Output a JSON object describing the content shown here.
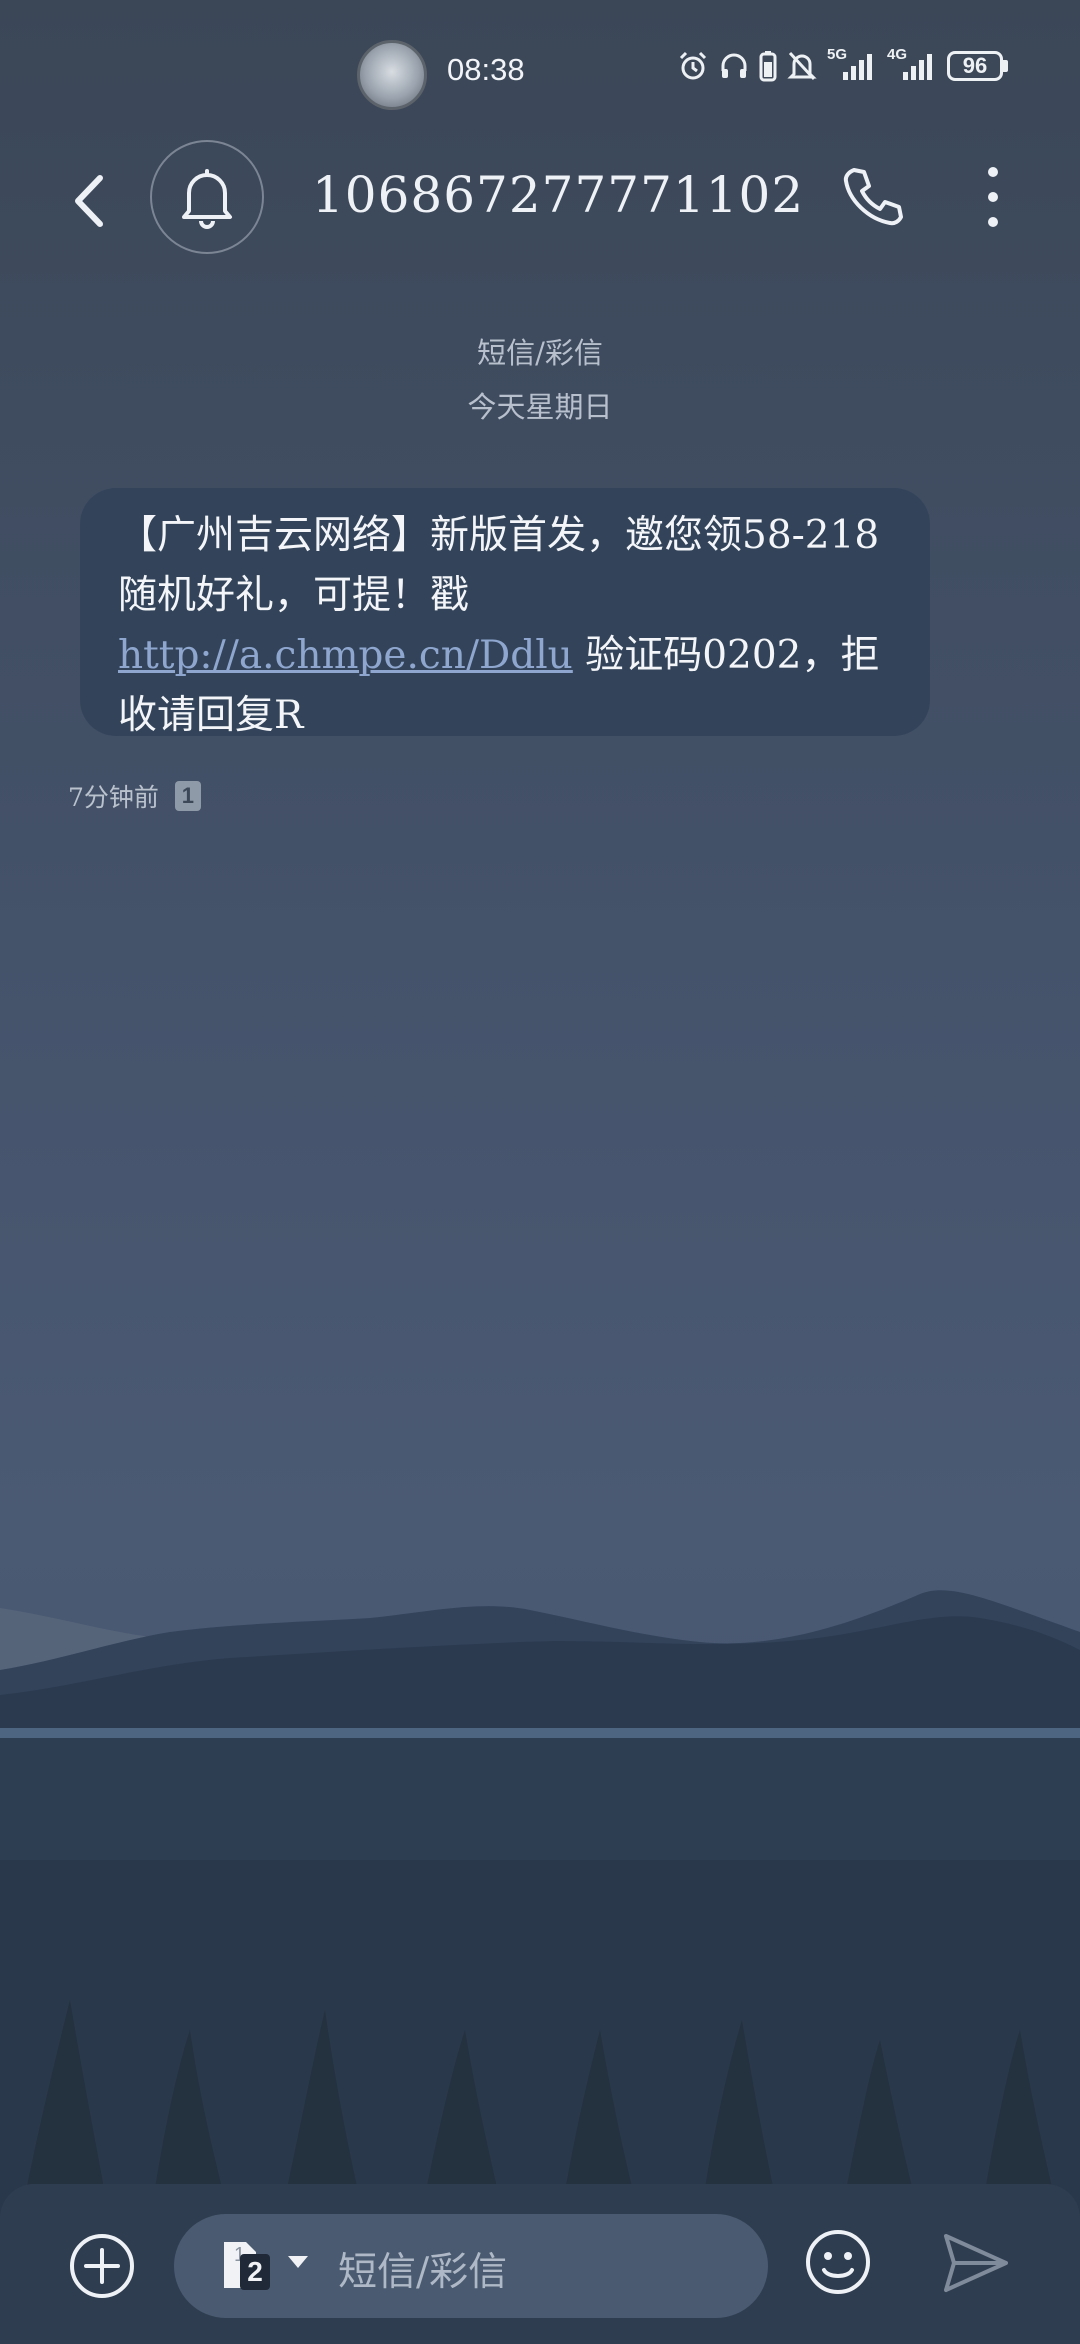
{
  "status_bar": {
    "time": "08:38",
    "battery": "96",
    "icons": [
      "avatar-icon",
      "alarm-icon",
      "headphones-icon",
      "battery-saver-icon",
      "mute-icon",
      "5g-signal-icon",
      "4g-signal-icon",
      "battery-icon"
    ],
    "network_5g": "5G",
    "network_4g": "4G"
  },
  "header": {
    "sender": "106867277771102",
    "icons": [
      "back-icon",
      "bell-icon",
      "phone-icon",
      "more-icon"
    ]
  },
  "conversation": {
    "channel": "短信/彩信",
    "date": "今天星期日",
    "message": {
      "text_before_link": "【广州吉云网络】新版首发，邀您领58-218随机好礼，可提！戳 ",
      "link": "http://a.chmpe.cn/Ddlu",
      "text_after_link": " 验证码0202，拒收请回复R",
      "time": "7分钟前",
      "sim": "1"
    }
  },
  "composer": {
    "placeholder": "短信/彩信",
    "sim_number": "2",
    "sim_digit_small": "1",
    "icons": [
      "add-icon",
      "sim-card-icon",
      "dropdown-icon",
      "emoji-icon",
      "send-icon"
    ]
  },
  "colors": {
    "background_top": "#3b4757",
    "bubble": "#33445a",
    "link": "#8fa7cf",
    "composer": "#2f3d50"
  }
}
